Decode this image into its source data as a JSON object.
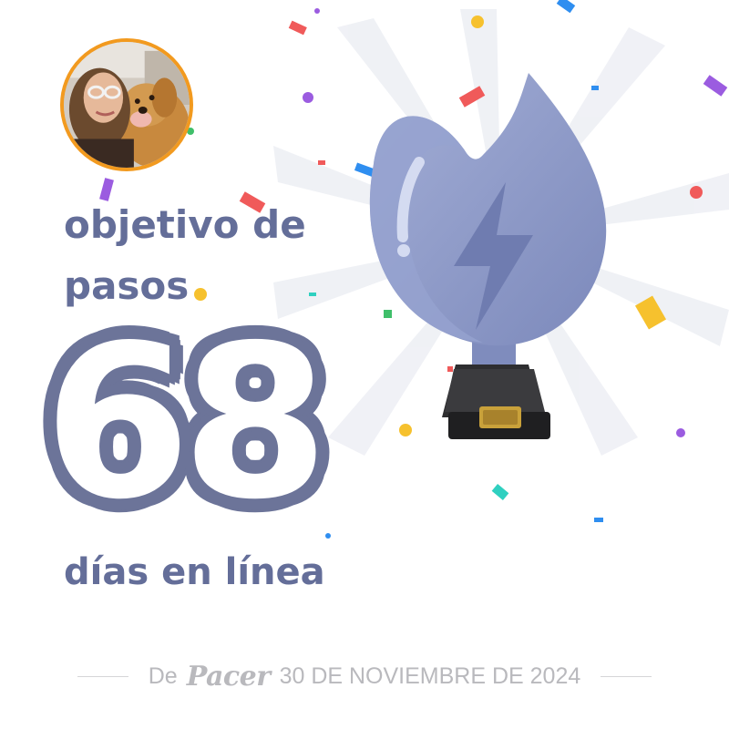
{
  "card": {
    "goal_line_1": "objetivo de",
    "goal_line_2": "pasos",
    "streak_days": "68",
    "streak_label": "días en línea",
    "footer": {
      "from": "De",
      "brand": "Pacer",
      "date": "30 DE NOVIEMBRE DE 2024"
    },
    "icons": {
      "avatar": "user-photo-avatar",
      "trophy": "flame-trophy-icon",
      "bolt": "lightning-bolt-icon"
    },
    "colors": {
      "text": "#646e99",
      "number_outline": "#6c7499",
      "avatar_ring": "#f29a1f",
      "trophy_body": "#8f9bc8",
      "trophy_base": "#3a3a3c",
      "plaque": "#c9a13a",
      "footer_text": "#b9b9bd"
    }
  }
}
